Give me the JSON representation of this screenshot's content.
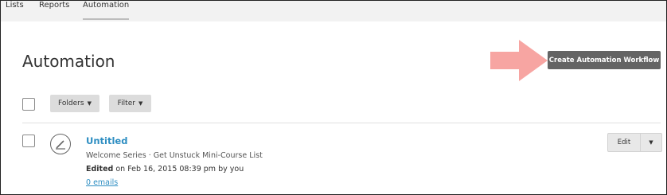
{
  "nav": {
    "tabs": [
      {
        "label": "Lists",
        "active": false
      },
      {
        "label": "Reports",
        "active": false
      },
      {
        "label": "Automation",
        "active": true
      }
    ]
  },
  "page": {
    "title": "Automation",
    "create_button": "Create Automation Workflow",
    "folders_label": "Folders",
    "filter_label": "Filter"
  },
  "workflow": {
    "title": "Untitled",
    "list": "Welcome Series · Get Unstuck Mini-Course List",
    "edited_label": "Edited",
    "edited_rest": " on Feb 16, 2015 08:39 pm by you",
    "emails": "0 emails",
    "edit_label": "Edit"
  },
  "icons": {
    "folders_chevron": "chevron-down-icon",
    "filter_chevron": "chevron-down-icon",
    "edit_more": "chevron-down-icon",
    "workflow": "pencil-circle-icon",
    "annotation": "arrow-right-icon"
  },
  "colors": {
    "primary_button": "#646464",
    "link": "#2e8ec2",
    "annotation_arrow": "#f7a5a2"
  }
}
